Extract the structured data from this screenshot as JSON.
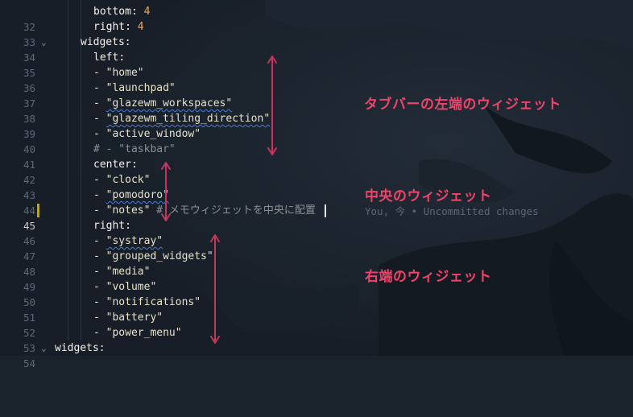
{
  "editor": {
    "lines": [
      {
        "num": "32",
        "indent": 5,
        "key": "bottom",
        "value": "4"
      },
      {
        "num": "33",
        "indent": 5,
        "key": "right",
        "value": "4"
      },
      {
        "num": "34",
        "indent": 4,
        "key": "widgets",
        "fold": "chevron-down-icon"
      },
      {
        "num": "35",
        "indent": 5,
        "key": "left"
      },
      {
        "num": "36",
        "indent": 5,
        "item": "\"home\""
      },
      {
        "num": "37",
        "indent": 5,
        "item": "\"launchpad\""
      },
      {
        "num": "38",
        "indent": 5,
        "item": "\"glazewm_workspaces\""
      },
      {
        "num": "39",
        "indent": 5,
        "item": "\"glazewm_tiling_direction\""
      },
      {
        "num": "40",
        "indent": 5,
        "item": "\"active_window\""
      },
      {
        "num": "41",
        "indent": 5,
        "comment": "# - \"taskbar\""
      },
      {
        "num": "42",
        "indent": 5,
        "key": "center"
      },
      {
        "num": "43",
        "indent": 5,
        "item": "\"clock\""
      },
      {
        "num": "44",
        "indent": 5,
        "item": "\"pomodoro\""
      },
      {
        "num": "45",
        "indent": 5,
        "item": "\"notes\"",
        "trailing_comment": "# メモウィジェットを中央に配置",
        "active": true
      },
      {
        "num": "46",
        "indent": 5,
        "key": "right"
      },
      {
        "num": "47",
        "indent": 5,
        "item": "\"systray\""
      },
      {
        "num": "48",
        "indent": 5,
        "item": "\"grouped_widgets\""
      },
      {
        "num": "49",
        "indent": 5,
        "item": "\"media\""
      },
      {
        "num": "50",
        "indent": 5,
        "item": "\"volume\""
      },
      {
        "num": "51",
        "indent": 5,
        "item": "\"notifications\""
      },
      {
        "num": "52",
        "indent": 5,
        "item": "\"battery\""
      },
      {
        "num": "53",
        "indent": 5,
        "item": "\"power_menu\""
      },
      {
        "num": "54",
        "indent": 0,
        "key": "widgets",
        "fold": "chevron-down-icon"
      }
    ],
    "inline_blame": "You, 今 • Uncommitted changes"
  },
  "annotations": {
    "left": "タブバーの左端のウィジェット",
    "center": "中央のウィジェット",
    "right": "右端のウィジェット"
  },
  "colors": {
    "background": "#1a222c",
    "annotation": "#f0436a",
    "arrow": "#c4365b",
    "string": "#e7e2c9",
    "number": "#f2a65a",
    "comment": "#8b8f96",
    "line_number": "#5f6a78"
  }
}
